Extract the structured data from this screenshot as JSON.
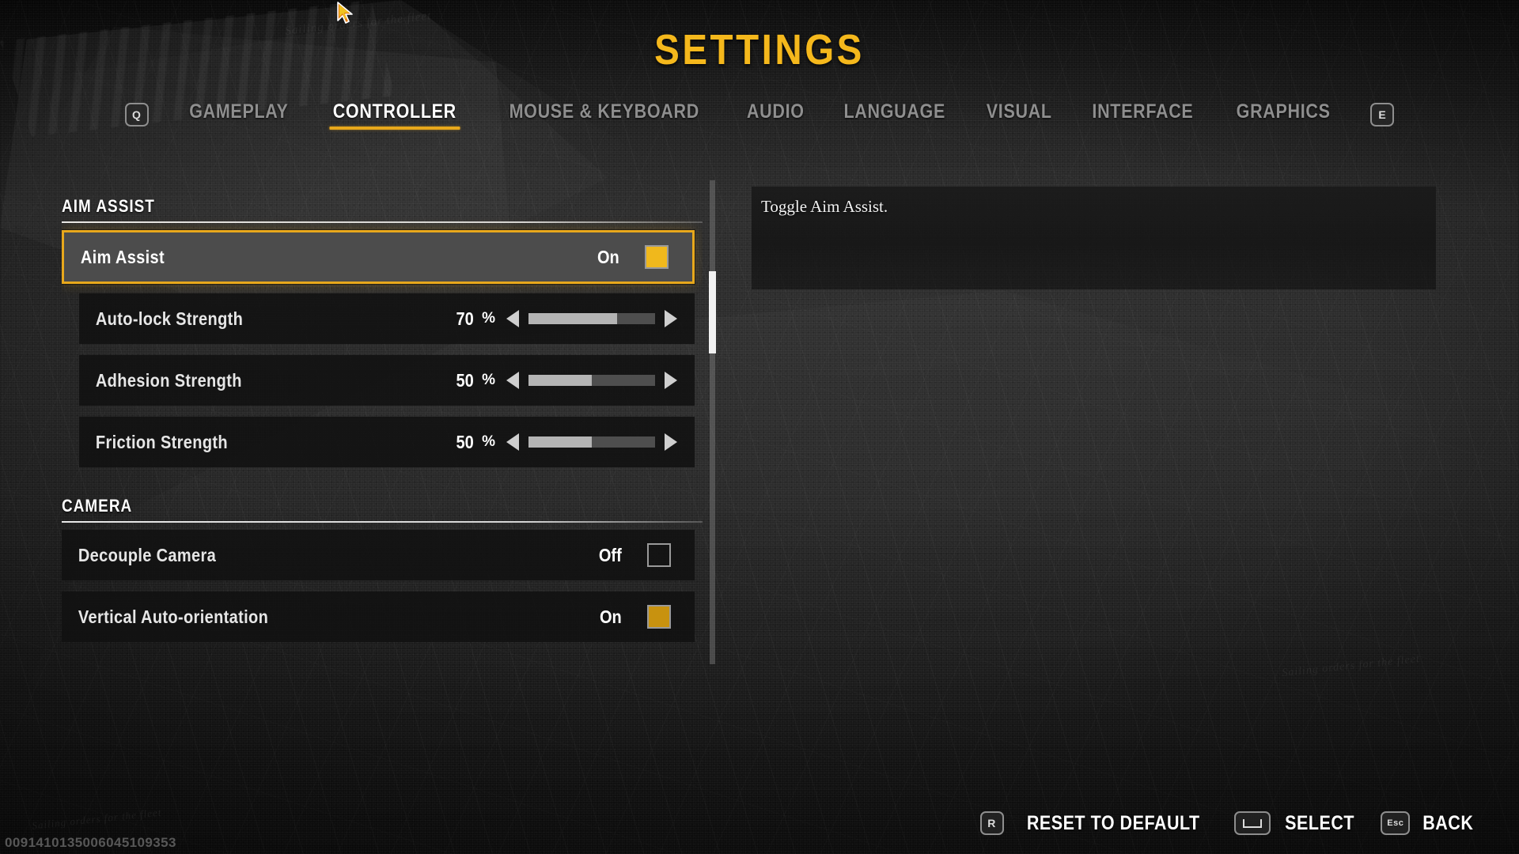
{
  "title": "SETTINGS",
  "nav": {
    "prev_key": "Q",
    "next_key": "E",
    "tabs": [
      {
        "label": "GAMEPLAY",
        "active": false
      },
      {
        "label": "CONTROLLER",
        "active": true
      },
      {
        "label": "MOUSE & KEYBOARD",
        "active": false
      },
      {
        "label": "AUDIO",
        "active": false
      },
      {
        "label": "LANGUAGE",
        "active": false
      },
      {
        "label": "VISUAL",
        "active": false
      },
      {
        "label": "INTERFACE",
        "active": false
      },
      {
        "label": "GRAPHICS",
        "active": false
      }
    ]
  },
  "sections": [
    {
      "heading": "AIM ASSIST",
      "rows": [
        {
          "label": "Aim Assist",
          "value": "On",
          "control": "checkbox",
          "checked": true,
          "selected": true
        },
        {
          "label": "Auto-lock Strength",
          "value": "70",
          "unit": "%",
          "control": "slider",
          "percent": 70,
          "selected": false
        },
        {
          "label": "Adhesion Strength",
          "value": "50",
          "unit": "%",
          "control": "slider",
          "percent": 50,
          "selected": false
        },
        {
          "label": "Friction Strength",
          "value": "50",
          "unit": "%",
          "control": "slider",
          "percent": 50,
          "selected": false
        }
      ]
    },
    {
      "heading": "CAMERA",
      "rows": [
        {
          "label": "Decouple Camera",
          "value": "Off",
          "control": "checkbox",
          "checked": false,
          "selected": false
        },
        {
          "label": "Vertical Auto-orientation",
          "value": "On",
          "control": "checkbox",
          "checked": true,
          "selected": false
        }
      ]
    }
  ],
  "description": "Toggle Aim Assist.",
  "actions": [
    {
      "key": "R",
      "label": "RESET TO DEFAULT",
      "icon": "key-r"
    },
    {
      "key": "",
      "label": "SELECT",
      "icon": "spacebar-icon"
    },
    {
      "key": "Esc",
      "label": "BACK",
      "icon": "key-esc"
    }
  ],
  "build_number": "0091410135006045109353",
  "colors": {
    "accent": "#e8a81c",
    "title": "#f5b81c",
    "checkbox_on": "#f0b81c",
    "checkbox_on_dim": "#c8920f",
    "selected_row_bg": "#4c4c4c",
    "slider_fill": "#b4b4b4",
    "slider_track": "#4e4e4e"
  },
  "background_script_text": "Sailing orders for the fleet"
}
